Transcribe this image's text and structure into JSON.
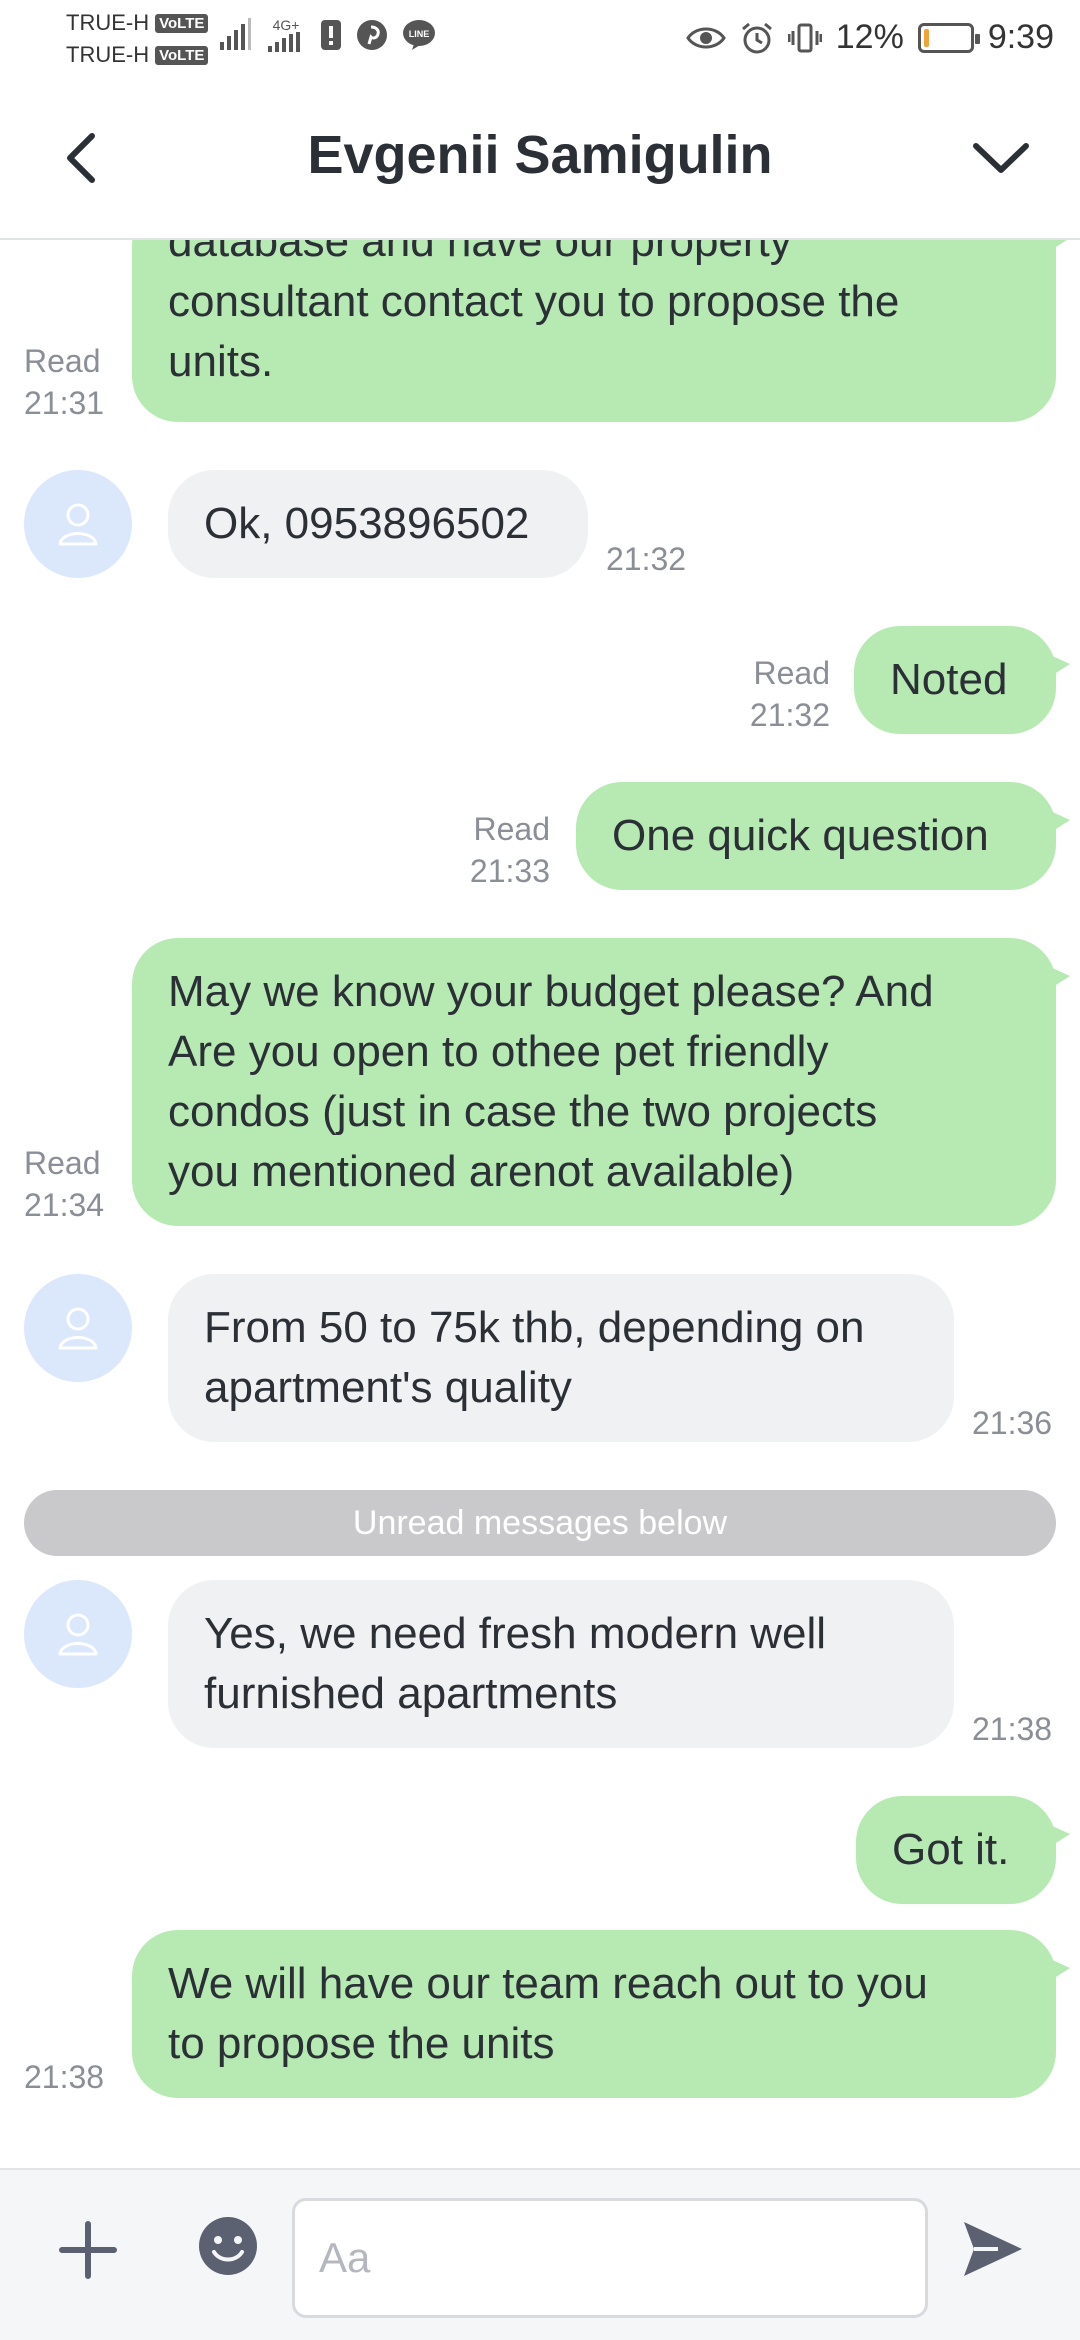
{
  "status_bar": {
    "carrier1": "TRUE-H",
    "carrier2": "TRUE-H",
    "volte": "VoLTE",
    "network": "4G+",
    "battery_percent": "12%",
    "battery_level": 0.12,
    "time": "9:39"
  },
  "header": {
    "title": "Evgenii Samigulin"
  },
  "messages": [
    {
      "text_lines": [
        "database and have our property",
        "consultant contact you to propose the",
        "units."
      ],
      "status": "Read",
      "time": "21:31"
    },
    {
      "text": "Ok, 0953896502",
      "time": "21:32"
    },
    {
      "text": "Noted",
      "status": "Read",
      "time": "21:32"
    },
    {
      "text": "One quick question",
      "status": "Read",
      "time": "21:33"
    },
    {
      "text_lines": [
        "May we know your budget please? And",
        "Are you open to othee pet friendly",
        "condos (just in case the two projects",
        "you mentioned arenot available)"
      ],
      "status": "Read",
      "time": "21:34"
    },
    {
      "text_lines": [
        "From 50 to 75k thb, depending on",
        "apartment's quality"
      ],
      "time": "21:36"
    },
    {
      "text_lines": [
        "Yes, we need fresh modern well",
        "furnished apartments"
      ],
      "time": "21:38"
    },
    {
      "text": "Got it."
    },
    {
      "text_lines": [
        "We will have our team reach out to you",
        "to propose the units"
      ],
      "time": "21:38"
    }
  ],
  "divider": {
    "label": "Unread messages below"
  },
  "input": {
    "placeholder": "Aa"
  },
  "colors": {
    "outgoing_bubble": "#b7e9b2",
    "incoming_bubble": "#f0f1f3",
    "avatar_bg": "#dbe7fb",
    "divider_bg": "#c9c9cb",
    "icon": "#5b6170"
  }
}
